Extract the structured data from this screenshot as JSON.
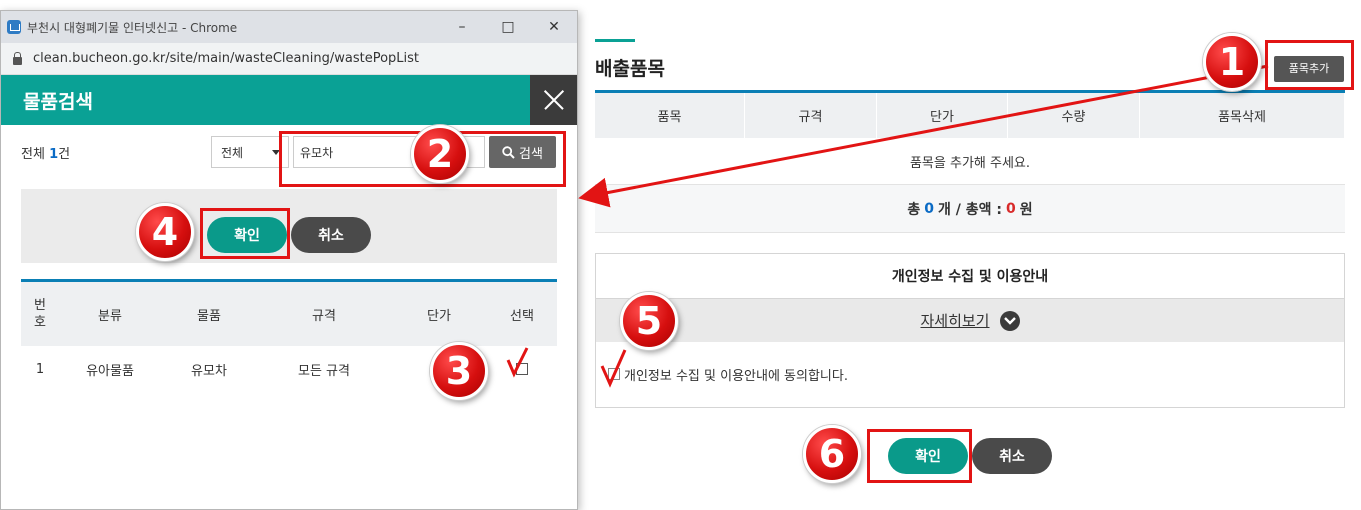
{
  "browser": {
    "title": "부천시 대형폐기물 인터넷신고 - Chrome",
    "url": "clean.bucheon.go.kr/site/main/wasteCleaning/wastePopList"
  },
  "popup": {
    "header": "물품검색",
    "count_prefix": "전체 ",
    "count_value": "1",
    "count_suffix": "건",
    "category_select": "전체",
    "search_value": "유모차",
    "search_button": "검색",
    "confirm_button": "확인",
    "cancel_button": "취소",
    "table": {
      "headers": [
        "번\n호",
        "분류",
        "물품",
        "규격",
        "단가",
        "선택"
      ],
      "rows": [
        {
          "no": "1",
          "category": "유아물품",
          "item": "유모차",
          "spec": "모든 규격",
          "price": "",
          "selected": false
        }
      ]
    }
  },
  "main": {
    "section_title": "배출품목",
    "add_item_button": "품목추가",
    "table_headers": [
      "품목",
      "규격",
      "단가",
      "수량",
      "품목삭제"
    ],
    "empty_message": "품목을 추가해 주세요.",
    "total": {
      "prefix": "총 ",
      "count": "0",
      "mid": " 개 / 총액 : ",
      "amount": "0",
      "suffix": " 원"
    },
    "privacy": {
      "title": "개인정보 수집 및 이용안내",
      "more_link": "자세히보기",
      "agree_label": "개인정보 수집 및 이용안내에 동의합니다."
    },
    "confirm_button": "확인",
    "cancel_button": "취소"
  },
  "annotations": {
    "steps": [
      "1",
      "2",
      "3",
      "4",
      "5",
      "6"
    ],
    "accent_color": "#e21414"
  },
  "colors": {
    "teal": "#0aa195",
    "blue_rule": "#0a7fb5",
    "dark_button": "#4a4a4a"
  }
}
